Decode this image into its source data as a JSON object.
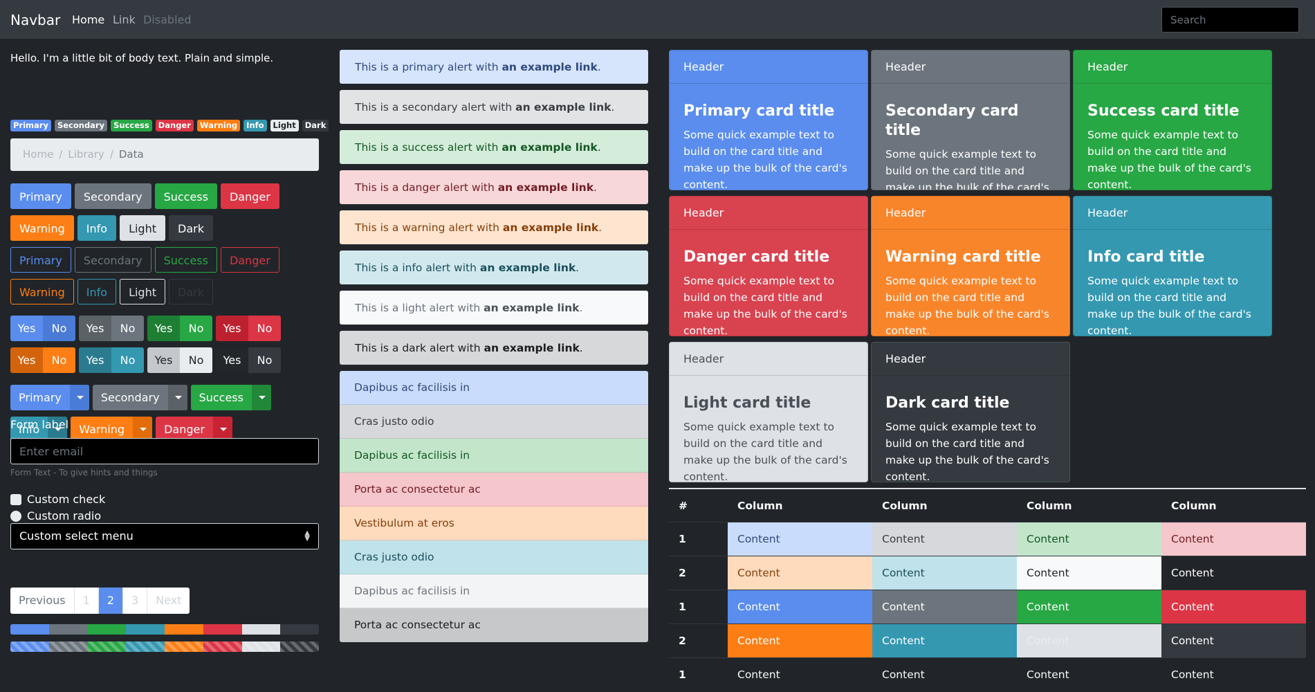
{
  "navbar": {
    "brand": "Navbar",
    "links": [
      "Home",
      "Link",
      "Disabled"
    ],
    "search_placeholder": "Search"
  },
  "body_text": "Hello. I'm a little bit of body text. Plain and simple.",
  "badges": [
    "Primary",
    "Secondary",
    "Success",
    "Danger",
    "Warning",
    "Info",
    "Light",
    "Dark"
  ],
  "breadcrumb": [
    "Home",
    "Library",
    "Data"
  ],
  "buttons": {
    "row1": [
      "Primary",
      "Secondary",
      "Success",
      "Danger"
    ],
    "row2": [
      "Warning",
      "Info",
      "Light",
      "Dark"
    ],
    "outline_row1": [
      "Primary",
      "Secondary",
      "Success",
      "Danger"
    ],
    "outline_row2": [
      "Warning",
      "Info",
      "Light",
      "Dark"
    ]
  },
  "toggles": {
    "yes": "Yes",
    "no": "No"
  },
  "dropdowns": {
    "row1": [
      "Primary",
      "Secondary",
      "Success"
    ],
    "row2": [
      "Info",
      "Warning",
      "Danger"
    ]
  },
  "form": {
    "label": "Form label",
    "email_placeholder": "Enter email",
    "help_text": "Form Text - To give hints and things",
    "check": "Custom check",
    "radio": "Custom radio",
    "select": "Custom select menu"
  },
  "pagination": [
    "Previous",
    "1",
    "2",
    "3",
    "Next"
  ],
  "alerts": [
    {
      "pre": "This is a primary alert with ",
      "link": "an example link",
      "post": "."
    },
    {
      "pre": "This is a secondary alert with ",
      "link": "an example link",
      "post": "."
    },
    {
      "pre": "This is a success alert with ",
      "link": "an example link",
      "post": "."
    },
    {
      "pre": "This is a danger alert with ",
      "link": "an example link",
      "post": "."
    },
    {
      "pre": "This is a warning alert with ",
      "link": "an example link",
      "post": "."
    },
    {
      "pre": "This is a info alert with ",
      "link": "an example link",
      "post": "."
    },
    {
      "pre": "This is a light alert with ",
      "link": "an example link",
      "post": "."
    },
    {
      "pre": "This is a dark alert with ",
      "link": "an example link",
      "post": "."
    }
  ],
  "list_group": [
    "Dapibus ac facilisis in",
    "Cras justo odio",
    "Dapibus ac facilisis in",
    "Porta ac consectetur ac",
    "Vestibulum at eros",
    "Cras justo odio",
    "Dapibus ac facilisis in",
    "Porta ac consectetur ac"
  ],
  "cards": [
    {
      "header": "Header",
      "title": "Primary card title",
      "text": "Some quick example text to build on the card title and make up the bulk of the card's content."
    },
    {
      "header": "Header",
      "title": "Secondary card title",
      "text": "Some quick example text to build on the card title and make up the bulk of the card's content."
    },
    {
      "header": "Header",
      "title": "Success card title",
      "text": "Some quick example text to build on the card title and make up the bulk of the card's content."
    },
    {
      "header": "Header",
      "title": "Danger card title",
      "text": "Some quick example text to build on the card title and make up the bulk of the card's content."
    },
    {
      "header": "Header",
      "title": "Warning card title",
      "text": "Some quick example text to build on the card title and make up the bulk of the card's content."
    },
    {
      "header": "Header",
      "title": "Info card title",
      "text": "Some quick example text to build on the card title and make up the bulk of the card's content."
    },
    {
      "header": "Header",
      "title": "Light card title",
      "text": "Some quick example text to build on the card title and make up the bulk of the card's content."
    },
    {
      "header": "Header",
      "title": "Dark card title",
      "text": "Some quick example text to build on the card title and make up the bulk of the card's content."
    }
  ],
  "table": {
    "headers": [
      "#",
      "Column",
      "Column",
      "Column",
      "Column"
    ],
    "rows": [
      [
        "1",
        "Content",
        "Content",
        "Content",
        "Content"
      ],
      [
        "2",
        "Content",
        "Content",
        "Content",
        "Content"
      ],
      [
        "1",
        "Content",
        "Content",
        "Content",
        "Content"
      ],
      [
        "2",
        "Content",
        "Content",
        "Content",
        "Content"
      ],
      [
        "1",
        "Content",
        "Content",
        "Content",
        "Content"
      ]
    ]
  },
  "colors": {
    "primary": "#5a8dee",
    "secondary": "#6c757d",
    "success": "#28a745",
    "danger": "#dc3545",
    "warning": "#fd7e14",
    "info": "#3498b1",
    "light": "#dee2e6",
    "dark": "#343a40"
  }
}
